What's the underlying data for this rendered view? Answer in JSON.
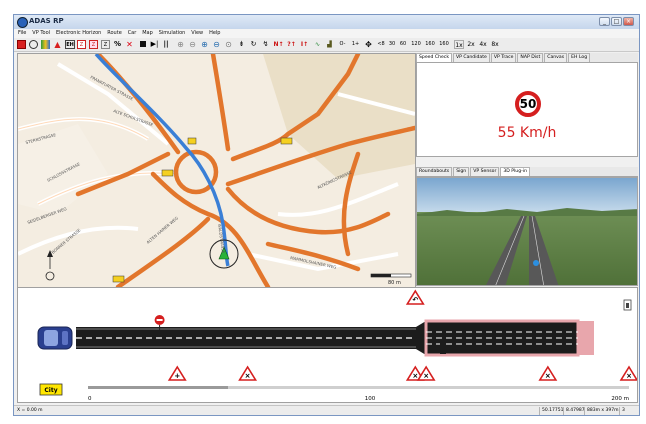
{
  "window": {
    "title": "ADAS RP",
    "min_glyph": "_",
    "max_glyph": "□",
    "close_glyph": "×"
  },
  "menu": [
    "File",
    "VP Tool",
    "Electronic Horizon",
    "Route",
    "Car",
    "Map",
    "Simulation",
    "View",
    "Help"
  ],
  "toolbar": {
    "zoom_levels": [
      "<8",
      "30",
      "60",
      "120",
      "160",
      "160"
    ],
    "multipliers": [
      "1x",
      "2x",
      "4x",
      "8x"
    ],
    "o_minus": "O-",
    "one_plus": "1+"
  },
  "map": {
    "street_labels": [
      "FRANKFURTER STRASSE",
      "ALTE SCHULSTRASSE",
      "STERNSTRASSE",
      "BONNER STRASSE",
      "SEIDELBERGER WEG",
      "SCHLOSSSTRASSE",
      "WALDSTRASSE",
      "MAMMOLSHAINER WEG",
      "ALTKÖNIGSTRASSE",
      "ALTEN HAINER WEG"
    ],
    "road_shields": [
      "A66",
      "A66",
      "A66",
      "A66"
    ],
    "scale": "80 m",
    "north": "N"
  },
  "right_panel": {
    "top_tabs": [
      "Speed Check",
      "VP Candidate",
      "VP Trace",
      "NAP Dist",
      "Canvas",
      "EH Log"
    ],
    "speed_limit": "50",
    "speed_text": "55 Km/h",
    "bottom_tabs": [
      "Roundabouts",
      "Sign",
      "VP Sensor",
      "3D Plug-in"
    ]
  },
  "horizon": {
    "area_badge": "City",
    "distance_ticks": [
      "0",
      "100",
      "200 m"
    ],
    "sign_positions_m": [
      33,
      59,
      121,
      125,
      170,
      200
    ],
    "top_sign_position_m": 121,
    "stop_position_m": 59
  },
  "status": {
    "x_value": "X = 0.00 m",
    "coords": [
      "50.17751",
      "8.47987",
      "883m x 397m",
      "3"
    ]
  },
  "colors": {
    "accent_red": "#d51f1f",
    "route_blue": "#3a7fd6",
    "road_orange": "#e2762c",
    "badge_yellow": "#ffe600"
  }
}
